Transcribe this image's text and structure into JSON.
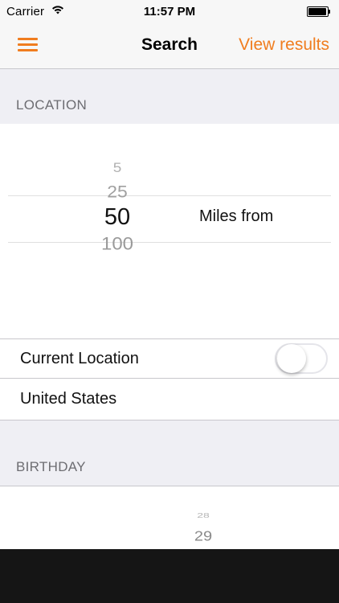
{
  "status_bar": {
    "carrier": "Carrier",
    "time": "11:57 PM"
  },
  "nav": {
    "title": "Search",
    "action": "View results",
    "accent_color": "#f07d1f"
  },
  "location_section": {
    "header": "LOCATION",
    "picker": {
      "options": [
        "5",
        "25",
        "50",
        "100"
      ],
      "selected": "50",
      "unit_label": "Miles from"
    },
    "current_location_label": "Current Location",
    "current_location_enabled": false,
    "country": "United States"
  },
  "birthday_section": {
    "header": "BIRTHDAY",
    "picker": {
      "visible_values": [
        "28",
        "29"
      ]
    }
  }
}
